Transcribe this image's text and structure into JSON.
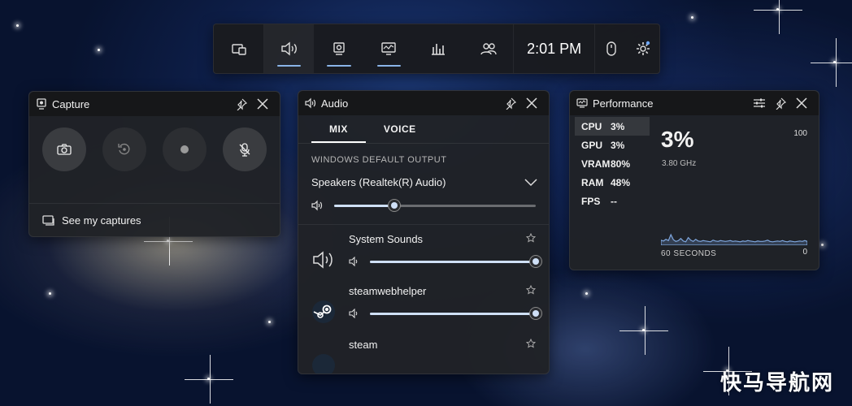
{
  "topbar": {
    "clock": "2:01 PM",
    "buttons": [
      {
        "name": "widget-menu-icon",
        "active": false
      },
      {
        "name": "audio-icon",
        "active": true
      },
      {
        "name": "capture-icon",
        "active": true
      },
      {
        "name": "performance-icon",
        "active": true
      },
      {
        "name": "resources-icon",
        "active": false
      },
      {
        "name": "social-icon",
        "active": false
      }
    ]
  },
  "capture": {
    "title": "Capture",
    "see_captures": "See my captures"
  },
  "audio": {
    "title": "Audio",
    "tabs": [
      "MIX",
      "VOICE"
    ],
    "active_tab": "MIX",
    "output_label": "WINDOWS DEFAULT OUTPUT",
    "device": "Speakers (Realtek(R) Audio)",
    "master_volume": 0.3,
    "apps": [
      {
        "name": "System Sounds",
        "volume": 1.0,
        "icon": "speaker-icon"
      },
      {
        "name": "steamwebhelper",
        "volume": 1.0,
        "icon": "steam-icon"
      },
      {
        "name": "steam",
        "volume": 1.0,
        "icon": "steam-icon"
      }
    ]
  },
  "performance": {
    "title": "Performance",
    "metrics": [
      {
        "key": "CPU",
        "value": "3%"
      },
      {
        "key": "GPU",
        "value": "3%"
      },
      {
        "key": "VRAM",
        "value": "80%"
      },
      {
        "key": "RAM",
        "value": "48%"
      },
      {
        "key": "FPS",
        "value": "--"
      }
    ],
    "big_value": "3%",
    "clock_speed": "3.80 GHz",
    "max": "100",
    "min": "0",
    "window": "60 SECONDS",
    "graph": [
      12,
      10,
      14,
      11,
      25,
      13,
      9,
      11,
      16,
      10,
      8,
      18,
      12,
      9,
      14,
      10,
      9,
      11,
      10,
      9,
      8,
      12,
      10,
      9,
      11,
      10,
      9,
      10,
      11,
      9,
      10,
      9,
      8,
      10,
      9,
      11,
      10,
      9,
      8,
      10,
      9,
      9,
      10,
      12,
      9,
      8,
      9,
      10,
      9,
      11,
      9,
      8,
      10,
      9,
      8,
      9,
      10,
      9,
      11,
      9
    ]
  },
  "watermark": "快马导航网"
}
